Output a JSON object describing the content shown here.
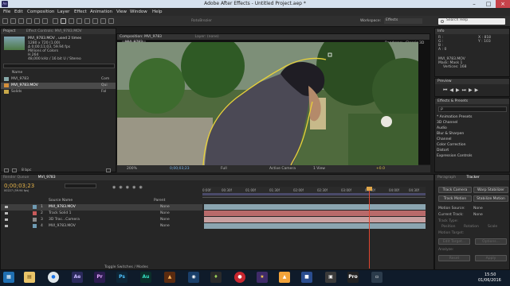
{
  "window": {
    "title": "Adobe After Effects - Untitled Project.aep *"
  },
  "menu": [
    "File",
    "Edit",
    "Composition",
    "Layer",
    "Effect",
    "Animation",
    "View",
    "Window",
    "Help"
  ],
  "toolbar": {
    "tool_label": "RotoBrezier",
    "workspace_label": "Workspace:",
    "workspace_value": "Effects",
    "search_placeholder": "Search Help"
  },
  "project": {
    "tab": "Project",
    "tab2": "Effect Controls: MVI_9783.MOV",
    "footage_name": "MVI_9783.MOV , used 2 times",
    "details": [
      "1280 x 720 (1.00)",
      "Δ 0;00;11;03, 59.94 fps",
      "Millions of Colors",
      "H.264",
      "48,000 kHz / 16 bit U / Stereo"
    ],
    "col_name": "Name",
    "items": [
      "MVI_9783",
      "MVI_9783.MOV",
      "Solids"
    ],
    "item_types": [
      "Com",
      "Qui",
      "Fol"
    ],
    "bpc": "8 bpc"
  },
  "comp": {
    "tab": "Composition: MVI_9783",
    "tab2": "Layer: (none)",
    "subtab": "MVI_9783",
    "renderer_label": "Renderer:",
    "renderer_value": "Classic 3D",
    "footer": {
      "zoom": "200%",
      "timecode": "0;00;03;23",
      "quality": "Full",
      "camera": "Active Camera",
      "views": "1 View",
      "exposure": "+0.0"
    }
  },
  "info": {
    "tab": "Info",
    "rgb": [
      "R :",
      "G :",
      "B :",
      "A : 0"
    ],
    "xy": [
      "X : 818",
      "Y : 103"
    ],
    "footage": "MVI_9783.MOV",
    "mask": "Mask: Mask 1",
    "vertices": "Vertices: 168"
  },
  "preview": {
    "tab": "Preview"
  },
  "effects": {
    "tab": "Effects & Presets",
    "search": "ρ",
    "items": [
      "* Animation Presets",
      "3D Channel",
      "Audio",
      "Blur & Sharpen",
      "Channel",
      "Color Correction",
      "Distort",
      "Expression Controls"
    ]
  },
  "timeline": {
    "render_tab": "Render Queue",
    "comp_tab": "MVI_9783",
    "timecode": "0;00;03;23",
    "timecode_sub": "00227 (59.94 fps)",
    "col_source": "Source Name",
    "col_parent": "Parent",
    "ticks": [
      "0:00f",
      "00:30f",
      "01:00f",
      "01:30f",
      "02:00f",
      "02:30f",
      "03:00f",
      "03:30f",
      "04:00f",
      "04:30f"
    ],
    "layers": [
      {
        "num": "1",
        "name": "MVI_9783.MOV",
        "parent": "None",
        "color": "#6f9bb3",
        "track": "#8ba5b0"
      },
      {
        "num": "2",
        "name": "Track Solid 1",
        "parent": "None",
        "color": "#c85a5a",
        "track": "#b86a6a"
      },
      {
        "num": "3",
        "name": "3D Trac...Camera",
        "parent": "None",
        "color": "#8a8a8a",
        "track": "#c8a0a0"
      },
      {
        "num": "4",
        "name": "MVI_9783.MOV",
        "parent": "None",
        "color": "#6f9bb3",
        "track": "#8ba5b0"
      }
    ],
    "footer": "Toggle Switches / Modes"
  },
  "tracker": {
    "tab1": "Paragraph",
    "tab2": "Tracker",
    "buttons": [
      "Track Camera",
      "Warp Stabilizer",
      "Track Motion",
      "Stabilize Motion"
    ],
    "motion_source_label": "Motion Source:",
    "motion_source": "None",
    "current_track_label": "Current Track:",
    "current_track": "None",
    "track_type_label": "Track Type:",
    "checks": [
      "Position",
      "Rotation",
      "Scale"
    ],
    "motion_target": "Motion Target:",
    "edit_target": "Edit Target...",
    "options": "Options...",
    "analyze": "Analyze:",
    "reset": "Reset",
    "apply": "Apply"
  },
  "taskbar": {
    "time": "15:50",
    "date": "01/06/2016"
  }
}
